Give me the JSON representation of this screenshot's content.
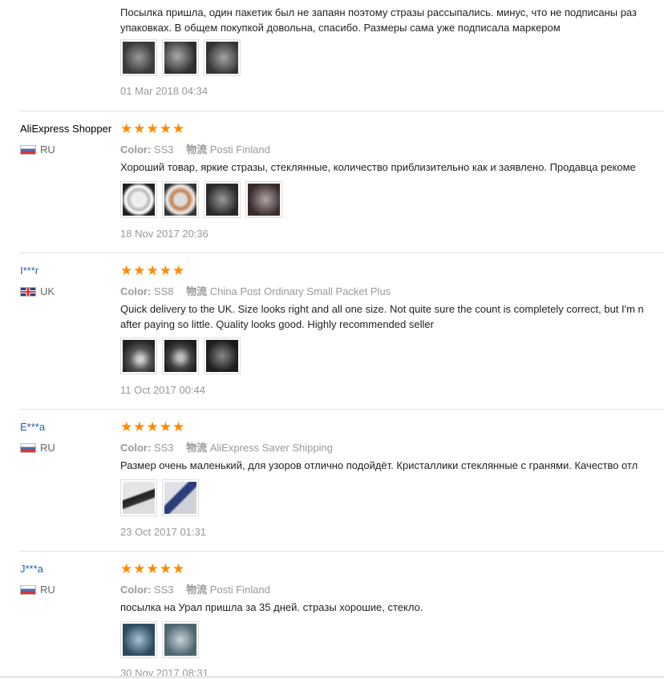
{
  "colors": {
    "star": "#ff8a00",
    "link": "#1f5fb3"
  },
  "top_review": {
    "text_lines": [
      "Посылка пришла, один пакетик был не запаян поэтому стразы рассыпались. минус, что не подписаны раз",
      "упаковках. В общем покупкой довольна, спасибо. Размеры сама уже подписала маркером"
    ],
    "date": "01 Mar 2018 04:34"
  },
  "labels": {
    "color": "Color:",
    "logistics": "物流"
  },
  "reviews": [
    {
      "user": "AliExpress Shopper",
      "country": "RU",
      "color": "SS3",
      "shipping": "Posti Finland",
      "text_lines": [
        "Хороший товар, яркие стразы, стеклянные, количество приблизительно как и заявлено. Продавца рекоме"
      ],
      "date": "18 Nov 2017 20:36"
    },
    {
      "user": "I***r",
      "country": "UK",
      "color": "SS8",
      "shipping": "China Post Ordinary Small Packet Plus",
      "text_lines": [
        "Quick delivery to the UK. Size looks right and all one size. Not quite sure the count is completely correct, but I'm n",
        "after paying so little. Quality looks good. Highly recommended seller"
      ],
      "date": "11 Oct 2017 00:44"
    },
    {
      "user": "E***a",
      "country": "RU",
      "color": "SS3",
      "shipping": "AliExpress Saver Shipping",
      "text_lines": [
        "Размер очень маленький, для узоров отлично подойдёт. Кристаллики стеклянные с гранями. Качество отл"
      ],
      "date": "23 Oct 2017 01:31"
    },
    {
      "user": "J***a",
      "country": "RU",
      "color": "SS3",
      "shipping": "Posti Finland",
      "text_lines": [
        "посылка на Урал пришла за 35 дней. стразы хорошие, стекло."
      ],
      "date": "30 Nov 2017 08:31"
    }
  ],
  "stars_glyph": "★"
}
